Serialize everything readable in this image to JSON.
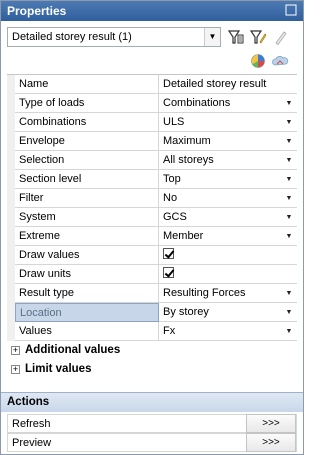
{
  "panel": {
    "title": "Properties"
  },
  "object_selector": {
    "value": "Detailed storey result (1)"
  },
  "properties": [
    {
      "name": "Name",
      "value": "Detailed storey result",
      "dropdown": false
    },
    {
      "name": "Type of loads",
      "value": "Combinations",
      "dropdown": true
    },
    {
      "name": "Combinations",
      "value": "ULS",
      "dropdown": true
    },
    {
      "name": "Envelope",
      "value": "Maximum",
      "dropdown": true
    },
    {
      "name": "Selection",
      "value": "All storeys",
      "dropdown": true
    },
    {
      "name": "Section level",
      "value": "Top",
      "dropdown": true
    },
    {
      "name": "Filter",
      "value": "No",
      "dropdown": true
    },
    {
      "name": "System",
      "value": "GCS",
      "dropdown": true
    },
    {
      "name": "Extreme",
      "value": "Member",
      "dropdown": true
    },
    {
      "name": "Draw values",
      "checked": true
    },
    {
      "name": "Draw units",
      "checked": true
    },
    {
      "name": "Result type",
      "value": "Resulting Forces",
      "dropdown": true
    },
    {
      "name": "Location",
      "value": "By storey",
      "dropdown": true
    },
    {
      "name": "Values",
      "value": "Fx",
      "dropdown": true
    }
  ],
  "sections": {
    "additional_values": "Additional values",
    "limit_values": "Limit values"
  },
  "actions": {
    "title": "Actions",
    "refresh_label": "Refresh",
    "preview_label": "Preview",
    "go_label": ">>>"
  }
}
